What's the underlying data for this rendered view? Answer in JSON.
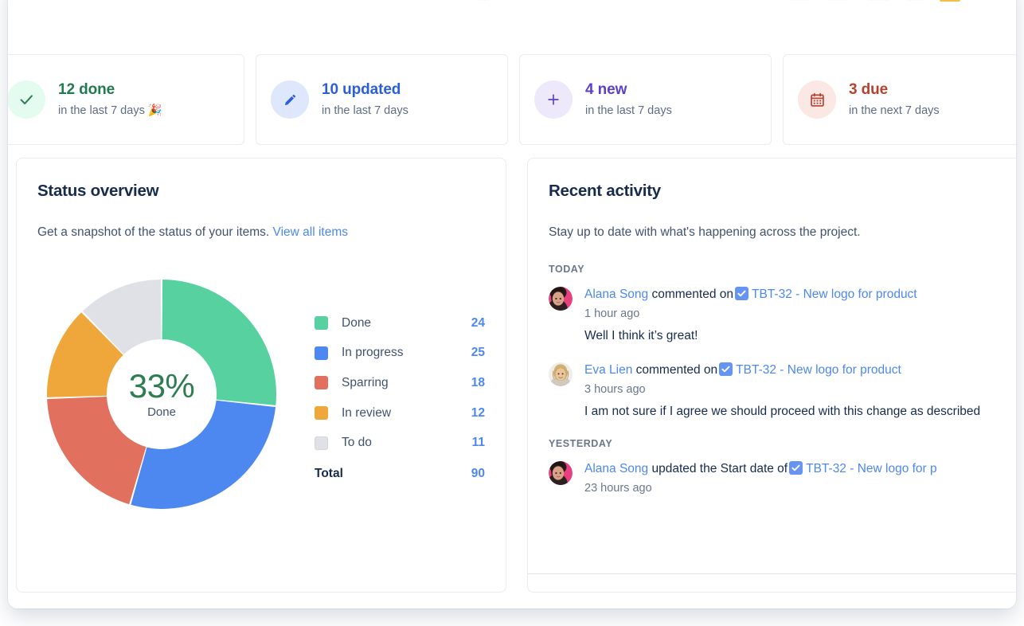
{
  "stats": [
    {
      "count_label": "12 done",
      "period": "in the last 7 days 🎉",
      "icon": "check-icon",
      "accent": "#1F7A4D",
      "bg": "#E3FCEF"
    },
    {
      "count_label": "10 updated",
      "period": "in the last 7 days",
      "icon": "pencil-icon",
      "accent": "#2B5FD9",
      "bg": "#DEE7FB"
    },
    {
      "count_label": "4 new",
      "period": "in the last 7 days",
      "icon": "plus-icon",
      "accent": "#5A3FCB",
      "bg": "#EDE9FB"
    },
    {
      "count_label": "3 due",
      "period": "in the next 7 days",
      "icon": "calendar-icon",
      "accent": "#B5412F",
      "bg": "#FBE8E4"
    }
  ],
  "status_overview": {
    "title": "Status overview",
    "description_prefix": "Get a snapshot of the status of your items.",
    "view_all_link": "View all items",
    "center_percent": "33%",
    "center_label": "Done"
  },
  "chart_data": {
    "type": "pie",
    "title": "Status overview",
    "categories": [
      "Done",
      "In progress",
      "Sparring",
      "In review",
      "To do"
    ],
    "values": [
      24,
      25,
      18,
      12,
      11
    ],
    "colors": [
      "#57D1A0",
      "#4C88F0",
      "#E2705E",
      "#EFA73B",
      "#DFE1E6"
    ],
    "total_label": "Total",
    "total": 90,
    "center_percent": "33%",
    "center_label": "Done",
    "legend_position": "right",
    "donut": true
  },
  "recent_activity": {
    "title": "Recent activity",
    "description": "Stay up to date with what's happening across the project.",
    "groups": [
      {
        "day": "TODAY",
        "items": [
          {
            "user": "Alana Song",
            "action": "commented on",
            "issue": "TBT-32 - New logo for product",
            "time": "1 hour ago",
            "comment": "Well I think it’s great!",
            "avatar": "avatar-alana",
            "issue_icon": "task-checkbox-icon"
          },
          {
            "user": "Eva Lien",
            "action": "commented on",
            "issue": "TBT-32 - New logo for product",
            "time": "3 hours ago",
            "comment": "I am not sure if I agree we should proceed with this change as described",
            "avatar": "avatar-eva",
            "issue_icon": "task-checkbox-icon"
          }
        ]
      },
      {
        "day": "YESTERDAY",
        "items": [
          {
            "user": "Alana Song",
            "action": "updated the Start date of",
            "issue": "TBT-32 - New logo for p",
            "time": "23 hours ago",
            "comment": "",
            "avatar": "avatar-alana",
            "issue_icon": "task-checkbox-icon"
          }
        ]
      }
    ]
  }
}
